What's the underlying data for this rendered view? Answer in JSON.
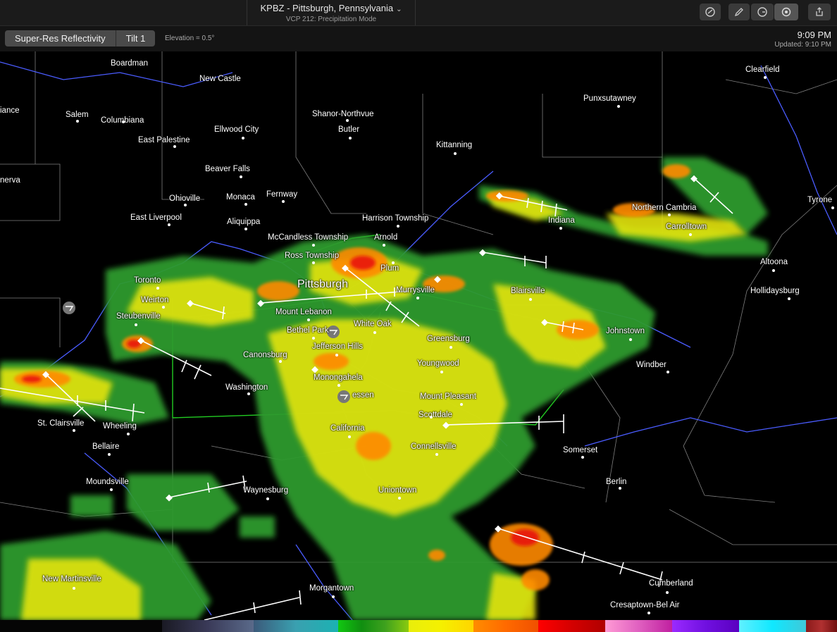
{
  "titlebar": {
    "station": "KPBZ - Pittsburgh, Pennsylvania",
    "mode": "VCP 212: Precipitation Mode",
    "buttons": [
      "storm-tracks-icon",
      "pencil-icon",
      "clock-icon",
      "locate-icon",
      "share-icon"
    ]
  },
  "toolbar": {
    "product": "Super-Res Reflectivity",
    "tilt": "Tilt 1",
    "elevation": "Elevation = 0.5°",
    "time": "9:09 PM",
    "updated": "Updated: 9:10 PM"
  },
  "map": {
    "cities": [
      "Boardman",
      "New Castle",
      "Clearfield",
      "Salem",
      "Columbiana",
      "Shanor-Northvue",
      "Punxsutawney",
      "Ellwood City",
      "Butler",
      "East Palestine",
      "Kittanning",
      "Beaver Falls",
      "Monaca",
      "Fernway",
      "Ohioville",
      "Tyrone",
      "East Liverpool",
      "Aliquippa",
      "Harrison Township",
      "Northern Cambria",
      "Indiana",
      "Carrolltown",
      "McCandless Township",
      "Arnold",
      "Ross Township",
      "Plum",
      "Altoona",
      "Toronto",
      "Pittsburgh",
      "Murrysville",
      "Blairsville",
      "Hollidaysburg",
      "Weirton",
      "Mount Lebanon",
      "Steubenville",
      "Bethel Park",
      "White Oak",
      "Johnstown",
      "Jefferson Hills",
      "Greensburg",
      "Canonsburg",
      "Youngwood",
      "Windber",
      "Monongahela",
      "Washington",
      "Mount Pleasant",
      "Scottdale",
      "St. Clairsville",
      "Wheeling",
      "California",
      "Connellsville",
      "Somerset",
      "Bellaire",
      "Moundsville",
      "Waynesburg",
      "Berlin",
      "Uniontown",
      "Cumberland",
      "New Martinsville",
      "Morgantown",
      "Cresaptown-Bel Air",
      "iance",
      "nerva",
      "essen"
    ]
  },
  "colors": {
    "background": "#000000",
    "green": "#3cb33c",
    "yellow": "#f2f20a",
    "orange": "#ff8a00",
    "red": "#e81010",
    "county_line": "#7f7f7f",
    "river": "#4a5cff",
    "highway": "#22cc22"
  }
}
